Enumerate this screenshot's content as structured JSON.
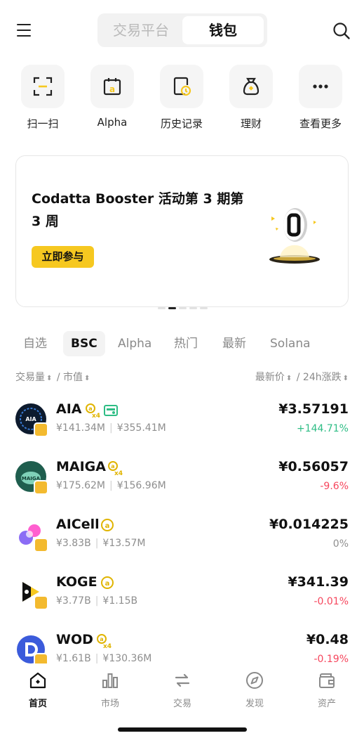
{
  "header": {
    "segments": [
      "交易平台",
      "钱包"
    ],
    "active_segment": "钱包"
  },
  "quick_actions": [
    {
      "label": "扫一扫",
      "icon": "scan-icon"
    },
    {
      "label": "Alpha",
      "icon": "alpha-calendar-icon"
    },
    {
      "label": "历史记录",
      "icon": "history-icon"
    },
    {
      "label": "理财",
      "icon": "money-bag-icon"
    },
    {
      "label": "查看更多",
      "icon": "more-icon"
    }
  ],
  "banner": {
    "title": "Codatta Booster 活动第 3 期第 3 周",
    "cta": "立即参与",
    "slide_count": 5,
    "active_slide": 2
  },
  "tabs": [
    "自选",
    "BSC",
    "Alpha",
    "热门",
    "最新",
    "Solana"
  ],
  "active_tab": "BSC",
  "sort": {
    "left_a": "交易量",
    "slash": "/",
    "left_b": "市值",
    "right_a": "最新价",
    "right_b": "24h涨跌"
  },
  "tokens": [
    {
      "symbol": "AIA",
      "volume": "¥141.34M",
      "mcap": "¥355.41M",
      "price": "¥3.57191",
      "change": "+144.71%",
      "multiplier": "x4",
      "extra_badge": true,
      "trend": "up"
    },
    {
      "symbol": "MAIGA",
      "volume": "¥175.62M",
      "mcap": "¥156.96M",
      "price": "¥0.56057",
      "change": "-9.6%",
      "multiplier": "x4",
      "extra_badge": false,
      "trend": "down"
    },
    {
      "symbol": "AICell",
      "volume": "¥3.83B",
      "mcap": "¥13.57M",
      "price": "¥0.014225",
      "change": "0%",
      "multiplier": "",
      "extra_badge": false,
      "trend": "flat"
    },
    {
      "symbol": "KOGE",
      "volume": "¥3.77B",
      "mcap": "¥1.15B",
      "price": "¥341.39",
      "change": "-0.01%",
      "multiplier": "",
      "extra_badge": false,
      "trend": "down"
    },
    {
      "symbol": "WOD",
      "volume": "¥1.61B",
      "mcap": "¥130.36M",
      "price": "¥0.48",
      "change": "-0.19%",
      "multiplier": "x4",
      "extra_badge": false,
      "trend": "down"
    }
  ],
  "nav": [
    {
      "label": "首页",
      "icon": "home-icon"
    },
    {
      "label": "市场",
      "icon": "market-icon"
    },
    {
      "label": "交易",
      "icon": "trade-icon"
    },
    {
      "label": "发现",
      "icon": "discover-icon"
    },
    {
      "label": "资产",
      "icon": "wallet-icon"
    }
  ],
  "active_nav": "首页",
  "colors": {
    "accent": "#f6c820",
    "up": "#2ebd85",
    "down": "#f6465d",
    "flat": "#8e8e8e",
    "bnb": "#f3ba2f"
  }
}
